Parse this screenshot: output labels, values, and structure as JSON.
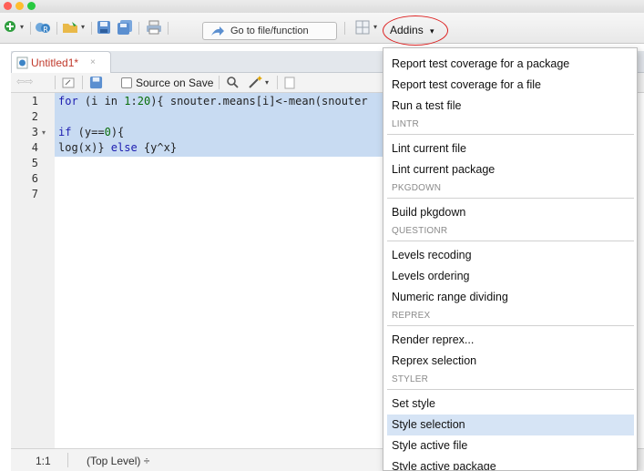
{
  "window": {
    "traffic_colors": [
      "#ff5f57",
      "#ffbd2e",
      "#28c940"
    ]
  },
  "toolbar": {
    "goto_label": "Go to file/function",
    "addins_label": "Addins",
    "addins_caret": "▾"
  },
  "editor": {
    "tab_title": "Untitled1*",
    "tab_close": "×",
    "source_on_save": "Source on Save",
    "line_numbers": [
      "1",
      "2",
      "3",
      "4",
      "5",
      "6",
      "7"
    ],
    "fold_marker": "▾",
    "lines": [
      {
        "a": "for",
        "b": " (i in ",
        "c": "1",
        "d": ":",
        "e": "20",
        "f": "){ snouter.means[i]<-mean(snouter"
      },
      {
        "a": "",
        "b": "",
        "c": "",
        "d": "",
        "e": "",
        "f": ""
      },
      {
        "a": "if",
        "b": " (y==",
        "c": "0",
        "d": "){",
        "e": "",
        "f": ""
      },
      {
        "a": "",
        "b": "log(x)} ",
        "c": "",
        "d": "",
        "e": "else",
        "f": " {y^x}"
      }
    ]
  },
  "status": {
    "position": "1:1",
    "level": "(Top Level) ÷"
  },
  "menu": {
    "items": [
      {
        "type": "item",
        "label": "Report test coverage for a package"
      },
      {
        "type": "item",
        "label": "Report test coverage for a file"
      },
      {
        "type": "item",
        "label": "Run a test file"
      },
      {
        "type": "section",
        "label": "LINTR"
      },
      {
        "type": "item",
        "label": "Lint current file"
      },
      {
        "type": "item",
        "label": "Lint current package"
      },
      {
        "type": "section",
        "label": "PKGDOWN"
      },
      {
        "type": "item",
        "label": "Build pkgdown"
      },
      {
        "type": "section",
        "label": "QUESTIONR"
      },
      {
        "type": "item",
        "label": "Levels recoding"
      },
      {
        "type": "item",
        "label": "Levels ordering"
      },
      {
        "type": "item",
        "label": "Numeric range dividing"
      },
      {
        "type": "section",
        "label": "REPREX"
      },
      {
        "type": "item",
        "label": "Render reprex..."
      },
      {
        "type": "item",
        "label": "Reprex selection"
      },
      {
        "type": "section",
        "label": "STYLER"
      },
      {
        "type": "item",
        "label": "Set style"
      },
      {
        "type": "item",
        "label": "Style selection",
        "highlighted": true
      },
      {
        "type": "item",
        "label": "Style active file"
      },
      {
        "type": "item",
        "label": "Style active package"
      }
    ],
    "highlight_color": "#d6e4f5"
  }
}
